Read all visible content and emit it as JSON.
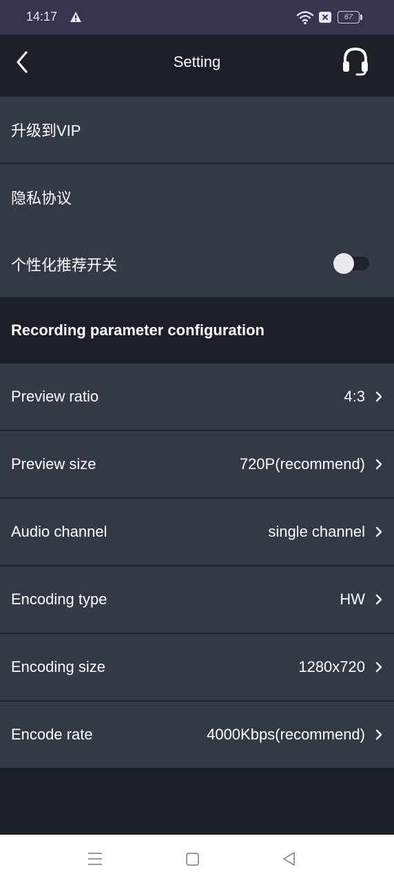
{
  "status_bar": {
    "time": "14:17",
    "battery_level": "67"
  },
  "app_bar": {
    "title": "Setting"
  },
  "general_items": [
    {
      "label": "升级到VIP"
    },
    {
      "label": "隐私协议"
    },
    {
      "label": "个性化推荐开关",
      "toggle_on": false
    }
  ],
  "section": {
    "title": "Recording parameter configuration"
  },
  "recording_items": [
    {
      "label": "Preview ratio",
      "value": "4:3"
    },
    {
      "label": "Preview size",
      "value": "720P(recommend)"
    },
    {
      "label": "Audio channel",
      "value": "single channel"
    },
    {
      "label": "Encoding type",
      "value": "HW"
    },
    {
      "label": "Encoding size",
      "value": "1280x720"
    },
    {
      "label": "Encode rate",
      "value": "4000Kbps(recommend)"
    }
  ],
  "colors": {
    "status_bar_bg": "#3a3350",
    "page_bg": "#1b2028",
    "row_bg": "#333a45",
    "toggle_knob": "#e9e9ec"
  }
}
